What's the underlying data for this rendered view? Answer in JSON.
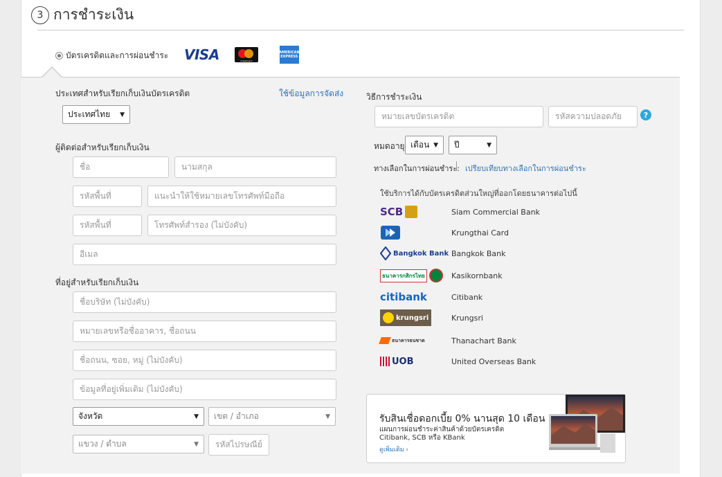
{
  "step": {
    "number": "3",
    "title": "การชำระเงิน"
  },
  "payment_option": {
    "label": "บัตรเครดิตและการผ่อนชำระ"
  },
  "card_logos": {
    "visa": "VISA",
    "mastercard": "mastercard",
    "amex_top": "AMERICAN",
    "amex_bottom": "EXPRESS"
  },
  "billing": {
    "country_heading": "ประเทศสำหรับเรียกเก็บเงินบัตรเครดิต",
    "use_shipping_link": "ใช้ข้อมูลการจัดส่ง",
    "country_value": "ประเทศไทย",
    "contact_heading": "ผู้ติดต่อสำหรับเรียกเก็บเงิน",
    "first_name_ph": "ชื่อ",
    "last_name_ph": "นามสกุล",
    "area_code_ph": "รหัสพื้นที่",
    "mobile_ph": "แนะนำให้ใช้หมายเลขโทรศัพท์มือถือ",
    "area_code2_ph": "รหัสพื้นที่",
    "alt_phone_ph": "โทรศัพท์สำรอง (ไม่บังคับ)",
    "email_ph": "อีเมล",
    "address_heading": "ที่อยู่สำหรับเรียกเก็บเงิน",
    "company_ph": "ชื่อบริษัท (ไม่บังคับ)",
    "house_ph": "หมายเลขหรือชื่ออาคาร, ชื่อถนน",
    "street_ph": "ชื่อถนน, ซอย, หมู่ (ไม่บังคับ)",
    "extra_ph": "ข้อมูลที่อยู่เพิ่มเติม (ไม่บังคับ)",
    "province_value": "จังหวัด",
    "district_value": "เขต / อำเภอ",
    "subdistrict_value": "แขวง / ตำบล",
    "postcode_ph": "รหัสไปรษณีย์"
  },
  "payment": {
    "heading": "วิธีการชำระเงิน",
    "card_number_ph": "หมายเลขบัตรเครดิต",
    "cvv_ph": "รหัสความปลอดภัย",
    "help": "?",
    "expiry_label": "หมดอายุ",
    "month_value": "เดือน",
    "year_value": "ปี",
    "installment_label": "ทางเลือกในการผ่อนชำระ:",
    "compare_link": "เปรียบเทียบทางเลือกในการผ่อนชำระ",
    "banks_intro": "ใช้บริการได้กับบัตรเครดิตส่วนใหญ่ที่ออกโดยธนาคารต่อไปนี้",
    "banks": [
      {
        "logo": "SCB",
        "name": "Siam Commercial Bank"
      },
      {
        "logo": "",
        "name": "Krungthai Card"
      },
      {
        "logo": "Bangkok Bank",
        "name": "Bangkok Bank"
      },
      {
        "logo": "ธนาคารกสิกรไทย",
        "name": "Kasikornbank"
      },
      {
        "logo": "citibank",
        "name": "Citibank"
      },
      {
        "logo": "krungsri",
        "name": "Krungsri"
      },
      {
        "logo": "ธนาคารธนชาต",
        "name": "Thanachart Bank"
      },
      {
        "logo": "UOB",
        "name": "United Overseas Bank"
      }
    ]
  },
  "promo": {
    "headline": "รับสินเชื่อดอกเบี้ย 0% นานสุด 10 เดือน",
    "sub1": "แผนการผ่อนชำระค่าสินค้าด้วยบัตรเครดิต",
    "sub2": "Citibank, SCB หรือ KBank",
    "link": "ดูเพิ่มเติม ›"
  },
  "colors": {
    "link": "#2f74b5",
    "help": "#2ba8e0",
    "panel": "#f2f2f2"
  }
}
